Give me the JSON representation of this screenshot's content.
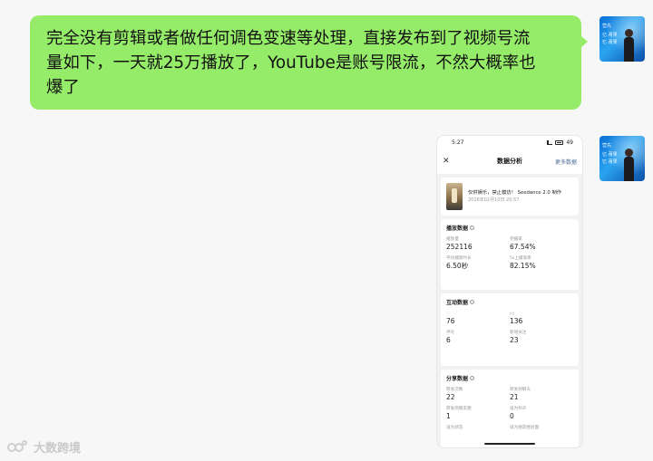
{
  "chat": {
    "message_lines": [
      "完全没有剪辑或者做任何调色变速等处理，直接发布到了视频号流",
      "量如下，一天就25万播放了，YouTube是账号限流，不然大概率也",
      "爆了"
    ]
  },
  "avatar": {
    "lines": [
      "营先",
      "亿·莆果",
      "忆·莆果"
    ]
  },
  "phone": {
    "status": {
      "time": "5:27",
      "battery": "49"
    },
    "nav": {
      "title": "数据分析",
      "more": "更多数据"
    },
    "video": {
      "title": "仅供娱乐，禁止模仿！ Seedance 2.0 制作",
      "date": "2026年02月10日 20:57"
    },
    "play": {
      "title": "播放数据",
      "metrics": [
        {
          "label": "播放量",
          "value": "252116"
        },
        {
          "label": "完播率",
          "value": "67.54%"
        },
        {
          "label": "平均播放时长",
          "value": "6.50秒"
        },
        {
          "label": "5s上播放率",
          "value": "82.15%"
        }
      ]
    },
    "interact": {
      "title": "互动数据",
      "metrics": [
        {
          "label": "",
          "value": "76",
          "icon": "heart-icon"
        },
        {
          "label": "",
          "value": "136",
          "icon": "thumbs-up-icon"
        },
        {
          "label": "评论",
          "value": "6"
        },
        {
          "label": "新增关注",
          "value": "23"
        }
      ]
    },
    "share": {
      "title": "分享数据",
      "metrics": [
        {
          "label": "转发次数",
          "value": "22"
        },
        {
          "label": "转发到聊天",
          "value": "21"
        },
        {
          "label": "转发到朋友圈",
          "value": "1"
        },
        {
          "label": "设为铃声",
          "value": "0"
        },
        {
          "label": "设为状态",
          "value": ""
        },
        {
          "label": "设为朋友圈封面",
          "value": ""
        }
      ]
    }
  },
  "watermark": {
    "text": "大数跨境"
  }
}
